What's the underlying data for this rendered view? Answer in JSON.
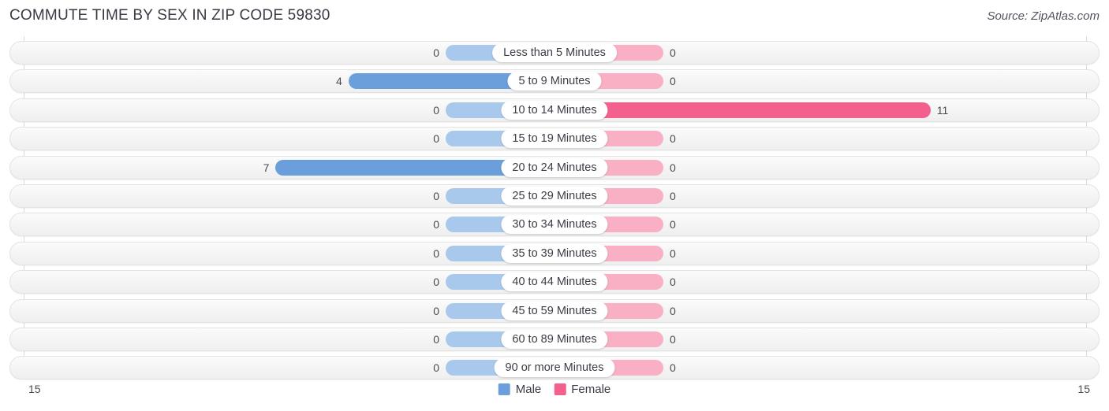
{
  "header": {
    "title": "COMMUTE TIME BY SEX IN ZIP CODE 59830",
    "source": "Source: ZipAtlas.com"
  },
  "legend": {
    "male_label": "Male",
    "female_label": "Female",
    "male_color": "#6a9fdc",
    "female_color": "#f4608e"
  },
  "axis": {
    "left_tick": "15",
    "right_tick": "15",
    "max": 15
  },
  "chart_data": {
    "type": "bar",
    "orientation": "horizontal-diverging",
    "title": "COMMUTE TIME BY SEX IN ZIP CODE 59830",
    "xlabel": "",
    "ylabel": "",
    "xlim": [
      15,
      15
    ],
    "grid": false,
    "legend_position": "bottom-center",
    "categories": [
      "Less than 5 Minutes",
      "5 to 9 Minutes",
      "10 to 14 Minutes",
      "15 to 19 Minutes",
      "20 to 24 Minutes",
      "25 to 29 Minutes",
      "30 to 34 Minutes",
      "35 to 39 Minutes",
      "40 to 44 Minutes",
      "45 to 59 Minutes",
      "60 to 89 Minutes",
      "90 or more Minutes"
    ],
    "series": [
      {
        "name": "Male",
        "color": "#6a9fdc",
        "values": [
          0,
          4,
          0,
          0,
          7,
          0,
          0,
          0,
          0,
          0,
          0,
          0
        ]
      },
      {
        "name": "Female",
        "color": "#f4608e",
        "values": [
          0,
          0,
          11,
          0,
          0,
          0,
          0,
          0,
          0,
          0,
          0,
          0
        ]
      }
    ]
  },
  "rows": [
    {
      "label": "Less than 5 Minutes",
      "male": "0",
      "female": "0",
      "male_v": 0,
      "female_v": 0
    },
    {
      "label": "5 to 9 Minutes",
      "male": "4",
      "female": "0",
      "male_v": 4,
      "female_v": 0
    },
    {
      "label": "10 to 14 Minutes",
      "male": "0",
      "female": "11",
      "male_v": 0,
      "female_v": 11
    },
    {
      "label": "15 to 19 Minutes",
      "male": "0",
      "female": "0",
      "male_v": 0,
      "female_v": 0
    },
    {
      "label": "20 to 24 Minutes",
      "male": "7",
      "female": "0",
      "male_v": 7,
      "female_v": 0
    },
    {
      "label": "25 to 29 Minutes",
      "male": "0",
      "female": "0",
      "male_v": 0,
      "female_v": 0
    },
    {
      "label": "30 to 34 Minutes",
      "male": "0",
      "female": "0",
      "male_v": 0,
      "female_v": 0
    },
    {
      "label": "35 to 39 Minutes",
      "male": "0",
      "female": "0",
      "male_v": 0,
      "female_v": 0
    },
    {
      "label": "40 to 44 Minutes",
      "male": "0",
      "female": "0",
      "male_v": 0,
      "female_v": 0
    },
    {
      "label": "45 to 59 Minutes",
      "male": "0",
      "female": "0",
      "male_v": 0,
      "female_v": 0
    },
    {
      "label": "60 to 89 Minutes",
      "male": "0",
      "female": "0",
      "male_v": 0,
      "female_v": 0
    },
    {
      "label": "90 or more Minutes",
      "male": "0",
      "female": "0",
      "male_v": 0,
      "female_v": 0
    }
  ]
}
